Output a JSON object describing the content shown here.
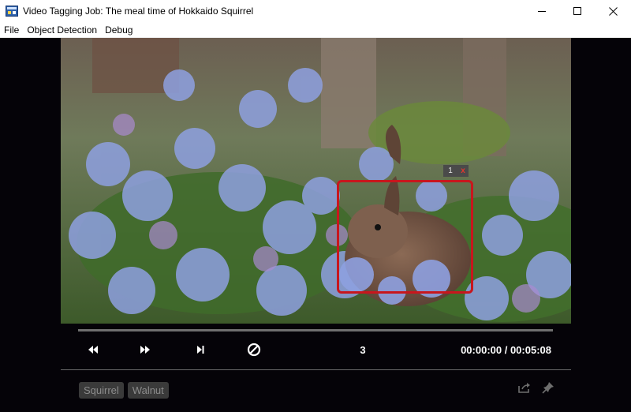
{
  "window": {
    "title": "Video Tagging Job: The meal time of Hokkaido Squirrel"
  },
  "menu": {
    "items": [
      "File",
      "Object Detection",
      "Debug"
    ]
  },
  "video": {
    "region": {
      "label": "1",
      "close": "x",
      "color": "#c8161d"
    }
  },
  "player": {
    "frame": "3",
    "time": "00:00:00 / 00:05:08"
  },
  "tags": [
    "Squirrel",
    "Walnut"
  ],
  "icons": {
    "rewind": "rewind-icon",
    "forward": "fast-forward-icon",
    "skip": "skip-to-end-icon",
    "clear": "prohibit-icon",
    "export": "export-icon",
    "pin": "pin-icon"
  }
}
